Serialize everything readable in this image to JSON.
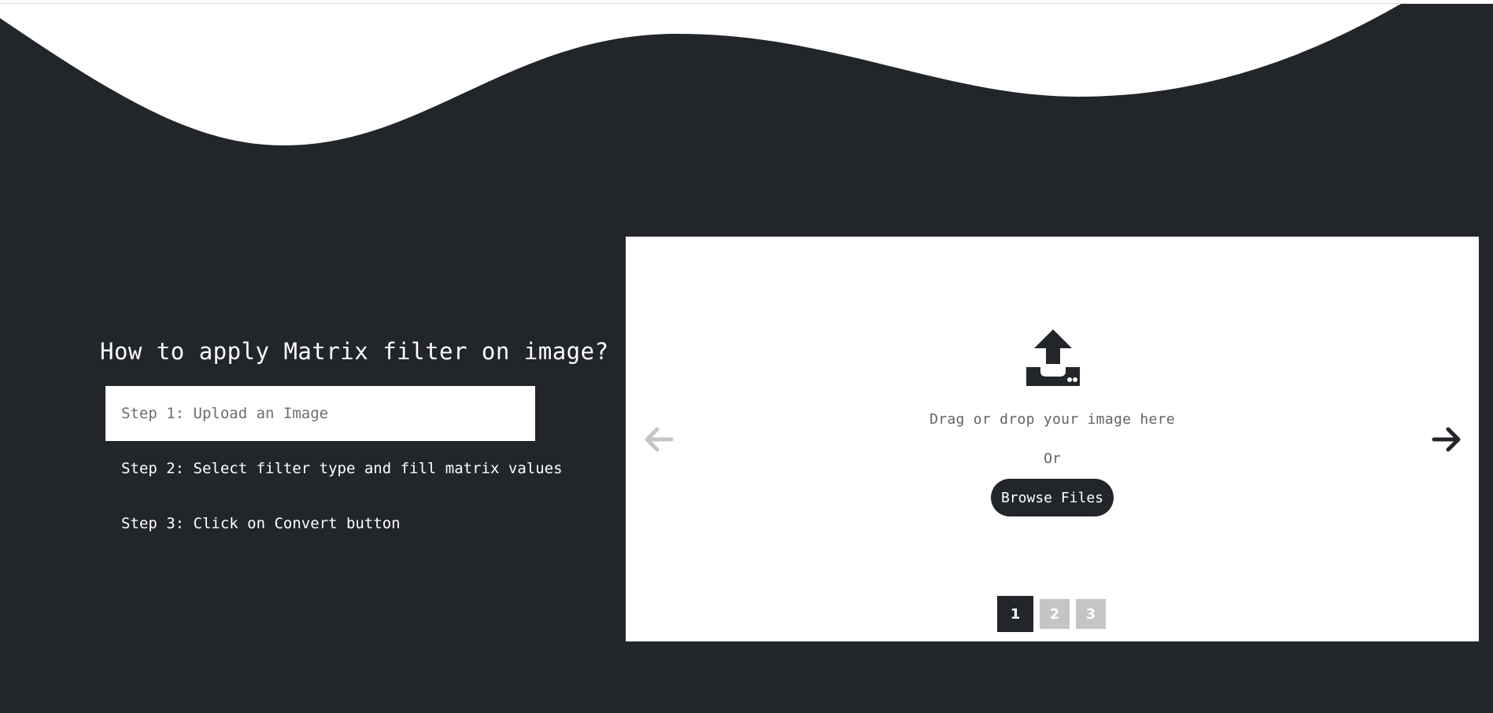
{
  "colors": {
    "dark_background": "#22252a",
    "panel_background": "#ffffff",
    "muted_arrow": "#c4c5c7",
    "inactive_page": "#c4c5c7"
  },
  "heading": "How to apply Matrix filter on image?",
  "steps": [
    {
      "label": "Step 1: Upload an Image",
      "active": true
    },
    {
      "label": "Step 2: Select filter type and fill matrix values",
      "active": false
    },
    {
      "label": "Step 3: Click on Convert button",
      "active": false
    }
  ],
  "upload": {
    "icon": "upload-tray-icon",
    "drag_text": "Drag or drop your image here",
    "or_text": "Or",
    "browse_label": "Browse Files"
  },
  "carousel": {
    "prev_icon": "arrow-left-icon",
    "next_icon": "arrow-right-icon",
    "pages": [
      "1",
      "2",
      "3"
    ],
    "current_page": "1"
  }
}
